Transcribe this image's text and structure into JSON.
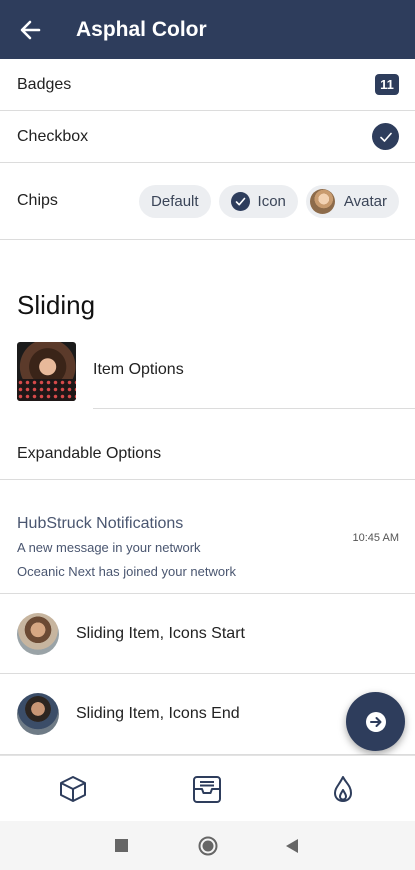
{
  "toolbar": {
    "title": "Asphal Color",
    "back_icon": "arrow-left-icon"
  },
  "rows": {
    "badges": {
      "label": "Badges",
      "badge_value": "11"
    },
    "checkbox": {
      "label": "Checkbox",
      "checked": true
    },
    "chips": {
      "label": "Chips",
      "items": [
        {
          "label": "Default"
        },
        {
          "label": "Icon",
          "icon": "check-icon"
        },
        {
          "label": "Avatar",
          "icon": "avatar"
        }
      ]
    }
  },
  "sliding": {
    "title": "Sliding",
    "item_options": {
      "label": "Item Options"
    },
    "expandable": {
      "label": "Expandable Options"
    },
    "notification": {
      "title": "HubStruck Notifications",
      "lines": [
        "A new message in your network",
        "Oceanic Next has joined your network"
      ],
      "time": "10:45 AM"
    },
    "icons_start": {
      "label": "Sliding Item, Icons Start"
    },
    "icons_end": {
      "label": "Sliding Item, Icons End"
    }
  },
  "fab": {
    "icon": "arrow-right-circle-icon"
  },
  "tabbar": {
    "tabs": [
      {
        "icon": "cube-icon"
      },
      {
        "icon": "inbox-icon"
      },
      {
        "icon": "flame-icon"
      }
    ]
  },
  "system_nav": {
    "buttons": [
      {
        "icon": "square-icon"
      },
      {
        "icon": "circle-icon"
      },
      {
        "icon": "triangle-back-icon"
      }
    ]
  },
  "colors": {
    "primary": "#2e3d5c",
    "chip_bg": "#eceef1",
    "divider": "#dcdcdc",
    "text_muted": "#4a5670"
  }
}
